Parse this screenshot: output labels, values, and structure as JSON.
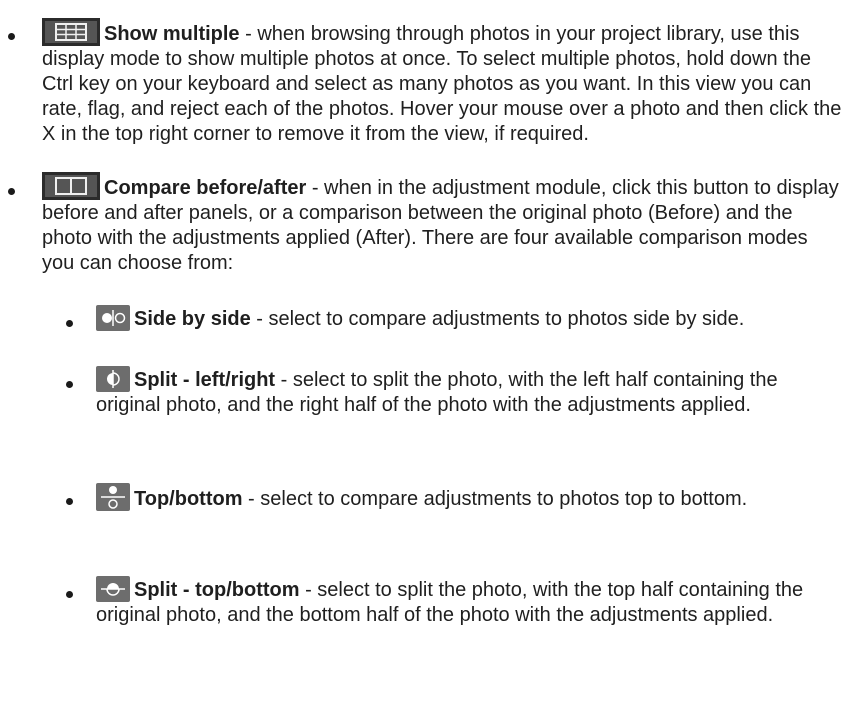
{
  "items": [
    {
      "icon": "grid-view-icon",
      "title": "Show multiple",
      "body": " - when browsing through photos in your project library, use this display mode to show multiple photos at once. To select multiple photos, hold down the Ctrl key on your keyboard and select as many photos as you want. In this view you can rate, flag, and reject each of the photos. Hover your mouse over a photo and then click the X in the top right corner to remove it from the view, if required."
    },
    {
      "icon": "compare-panels-icon",
      "title": "Compare before/after",
      "body": " - when in the adjustment module, click this button to display before and after panels, or a comparison between the original photo (Before) and the photo with the adjustments applied (After). There are four available comparison modes you can choose from:"
    }
  ],
  "subitems": [
    {
      "icon": "side-by-side-icon",
      "title": "Side by side",
      "body": " - select to compare adjustments to photos side by side."
    },
    {
      "icon": "split-left-right-icon",
      "title": "Split - left/right",
      "body": " - select to split the photo, with the left half containing the original photo, and the right half of the photo with the adjustments applied."
    },
    {
      "icon": "top-bottom-icon",
      "title": "Top/bottom",
      "body": " - select to compare adjustments to photos top to bottom."
    },
    {
      "icon": "split-top-bottom-icon",
      "title": "Split - top/bottom",
      "body": " - select to split the photo, with the top half containing the original photo, and the bottom half of the photo with the adjustments applied."
    }
  ]
}
